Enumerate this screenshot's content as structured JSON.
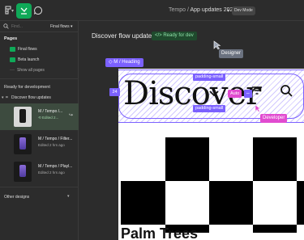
{
  "topbar": {
    "breadcrumb_project": "Tempo",
    "breadcrumb_sep": " / ",
    "breadcrumb_file": "App updates 2023",
    "dev_mode_label": "Dev Mode",
    "icons": [
      "figma-logo-icon",
      "dev-mode-icon",
      "comment-icon"
    ]
  },
  "sidebar": {
    "search_placeholder": "Find...",
    "page_select": "Final flows",
    "pages_title": "Pages",
    "pages": [
      {
        "label": "Final flows"
      },
      {
        "label": "Beta launch"
      }
    ],
    "show_all_pages": "Show all pages",
    "ready_title": "Ready for development",
    "group_label": "Discover flow updates",
    "frames": [
      {
        "title": "M / Tempo /...",
        "sub": "Edited 2...",
        "selected": true
      },
      {
        "title": "M / Tempo / Filter...",
        "sub": "Edited 2 hrs ago",
        "selected": false
      },
      {
        "title": "M / Tempo / Playl...",
        "sub": "Edited 2 hrs ago",
        "selected": false
      }
    ],
    "other_designs": "Other designs"
  },
  "canvas": {
    "flow_title": "Discover flow updates",
    "ready_badge": "</>  Ready for dev",
    "designer_label": "Designer",
    "developer_label": "Developer",
    "heading_tag": "M / Heading",
    "discover_text": "Discover",
    "padding_top": "padding-small",
    "padding_bottom": "padding-small",
    "auto_tag": "Auto",
    "side_number": "24",
    "palm_title": "Palm Trees"
  },
  "colors": {
    "accent_green": "#0fa958",
    "selection_purple": "#7b61ff",
    "developer_pink": "#e14bd0"
  }
}
